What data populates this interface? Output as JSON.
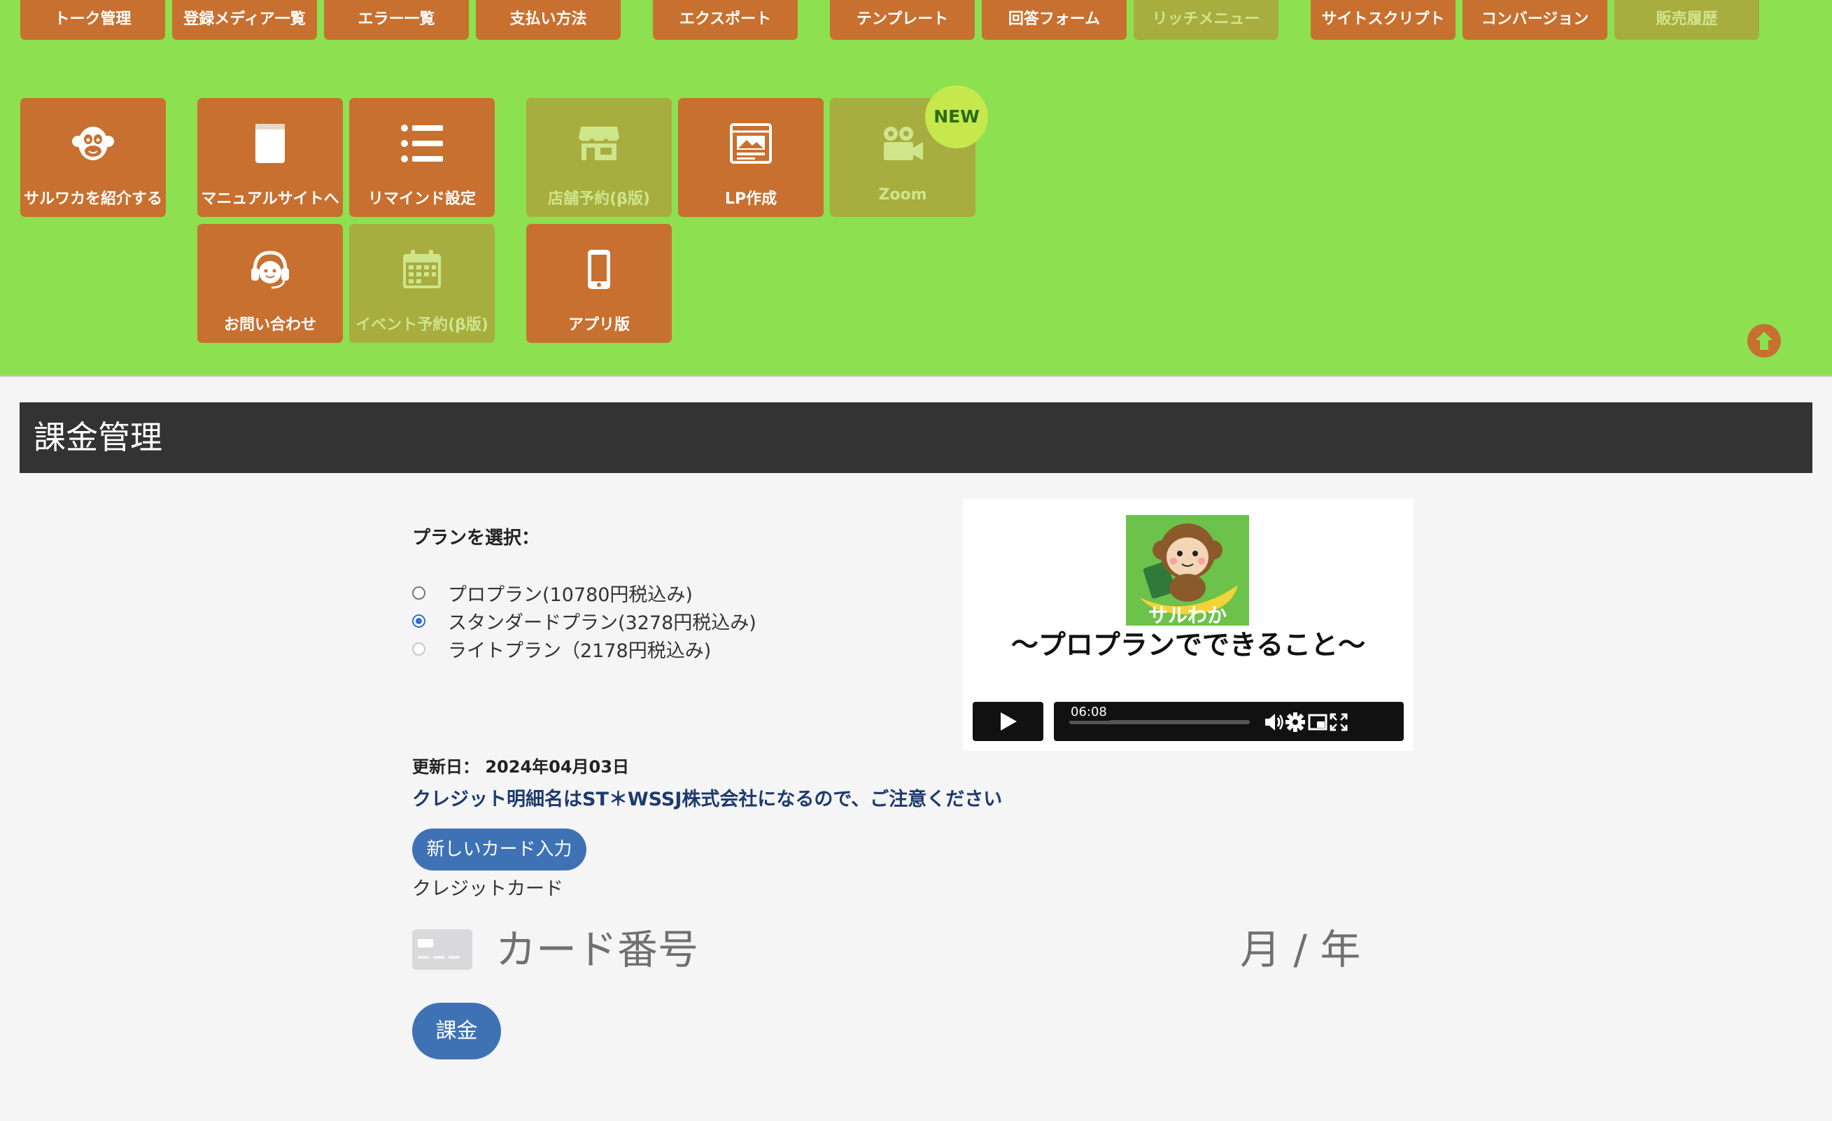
{
  "menu": {
    "strip": [
      {
        "label": "トーク管理",
        "disabled": false
      },
      {
        "label": "登録メディア一覧",
        "disabled": false
      },
      {
        "label": "エラー一覧",
        "disabled": false
      },
      {
        "label": "支払い方法",
        "disabled": false
      },
      {
        "label": "エクスポート",
        "disabled": false
      },
      {
        "label": "テンプレート",
        "disabled": false
      },
      {
        "label": "回答フォーム",
        "disabled": false
      },
      {
        "label": "リッチメニュー",
        "disabled": true
      },
      {
        "label": "サイトスクリプト",
        "disabled": false
      },
      {
        "label": "コンバージョン",
        "disabled": false
      },
      {
        "label": "販売履歴",
        "disabled": true
      }
    ],
    "tiles": [
      {
        "label": "サルワカを紹介する",
        "icon": "monkey-icon",
        "disabled": false
      },
      {
        "label": "マニュアルサイトへ",
        "icon": "book-icon",
        "disabled": false
      },
      {
        "label": "リマインド設定",
        "icon": "list-icon",
        "disabled": false
      },
      {
        "label": "店舗予約(β版)",
        "icon": "store-icon",
        "disabled": true
      },
      {
        "label": "LP作成",
        "icon": "webpage-icon",
        "disabled": false
      },
      {
        "label": "Zoom",
        "icon": "video-camera-icon",
        "disabled": true
      },
      {
        "label": "お問い合わせ",
        "icon": "headset-icon",
        "disabled": false
      },
      {
        "label": "イベント予約(β版)",
        "icon": "calendar-icon",
        "disabled": true
      },
      {
        "label": "アプリ版",
        "icon": "smartphone-icon",
        "disabled": false
      }
    ],
    "new_badge": "NEW"
  },
  "page": {
    "title": "課金管理"
  },
  "plan": {
    "label": "プランを選択：",
    "options": [
      {
        "label": "プロプラン(10780円税込み)",
        "checked": false
      },
      {
        "label": "スタンダードプラン(3278円税込み)",
        "checked": true
      },
      {
        "label": "ライトプラン（2178円税込み)",
        "checked": false
      }
    ]
  },
  "video": {
    "logo_text": "サルわか",
    "title": "〜プロプランでできること〜",
    "time": "06:08"
  },
  "billing": {
    "updated": "更新日： 2024年04月03日",
    "notice": "クレジット明細名はST＊WSSJ株式会社になるので、ご注意ください",
    "new_card_button": "新しいカード入力",
    "cc_label": "クレジットカード",
    "card_placeholder": "カード番号",
    "expiry_placeholder": "月 / 年",
    "charge_button": "課金"
  },
  "colors": {
    "top_background": "#8de04f",
    "tile": "#c87030",
    "tile_disabled": "#a8ad40",
    "header": "#333333",
    "button": "#3f72b5"
  }
}
